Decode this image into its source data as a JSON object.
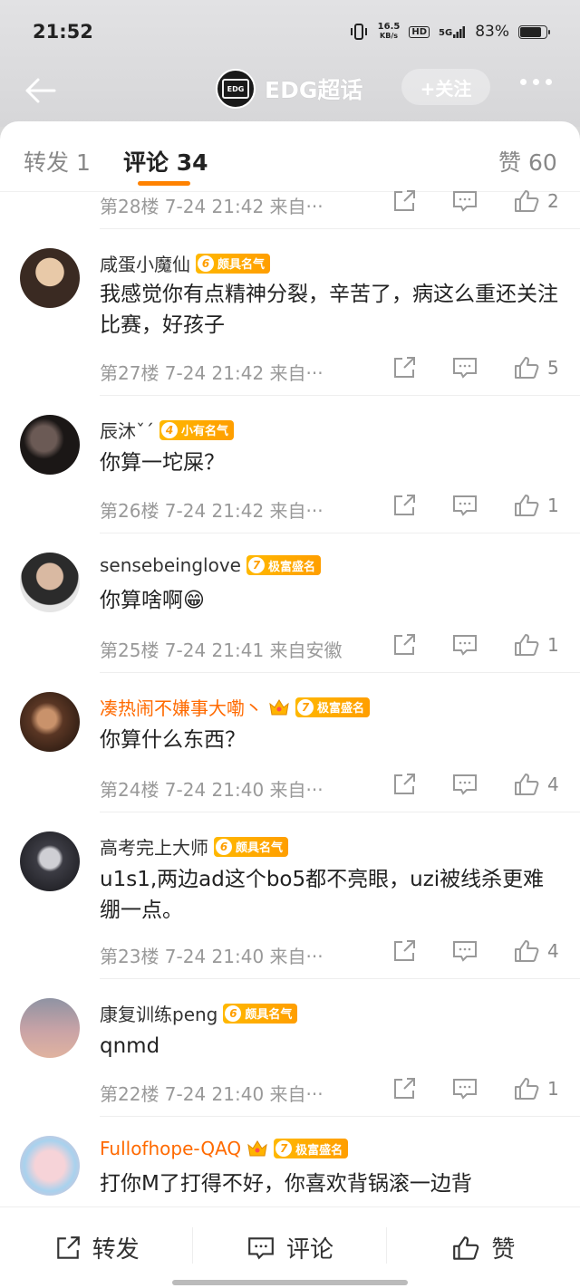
{
  "status_bar": {
    "time": "21:52",
    "net_speed_top": "16.5",
    "net_speed_bottom": "KB/s",
    "hd": "HD",
    "signal": "5G",
    "battery": "83%",
    "battery_level": 0.83
  },
  "header": {
    "logo_text": "EDG",
    "title": "EDG超话",
    "follow_label": "+关注"
  },
  "tabs": {
    "repost": "转发 1",
    "comments": "评论 34",
    "likes": "赞 60"
  },
  "comments": [
    {
      "floor_meta": "第28楼  7-24 21:42  来自···",
      "likes": "2"
    },
    {
      "username": "咸蛋小魔仙",
      "level": "6",
      "badge": "颇具名气",
      "text": "我感觉你有点精神分裂，辛苦了，病这么重还关注比赛，好孩子",
      "floor_meta": "第27楼  7-24 21:42  来自···",
      "likes": "5"
    },
    {
      "username": "辰沐ˇˊ",
      "level": "4",
      "badge": "小有名气",
      "text": "你算一坨屎？",
      "floor_meta": "第26楼  7-24 21:42  来自···",
      "likes": "1"
    },
    {
      "username": "sensebeinglove",
      "level": "7",
      "badge": "极富盛名",
      "text": "你算啥啊😁",
      "floor_meta": "第25楼  7-24 21:41  来自安徽",
      "likes": "1"
    },
    {
      "username": "凑热闹不嫌事大嘞丶",
      "level": "7",
      "badge": "极富盛名",
      "text": "你算什么东西？",
      "floor_meta": "第24楼  7-24 21:40  来自···",
      "likes": "4"
    },
    {
      "username": "高考完上大师",
      "level": "6",
      "badge": "颇具名气",
      "text": "u1s1,两边ad这个bo5都不亮眼，uzi被线杀更难绷一点。",
      "floor_meta": "第23楼  7-24 21:40  来自···",
      "likes": "4"
    },
    {
      "username": "康复训练peng",
      "level": "6",
      "badge": "颇具名气",
      "text": "qnmd",
      "floor_meta": "第22楼  7-24 21:40  来自···",
      "likes": "1"
    },
    {
      "username": "Fullofhope-QAQ",
      "level": "7",
      "badge": "极富盛名",
      "text": "打你M了打得不好，你喜欢背锅滚一边背"
    }
  ],
  "bottom_bar": {
    "repost": "转发",
    "comment": "评论",
    "like": "赞"
  },
  "colors": {
    "accent": "#ff8200",
    "vip_name": "#ff6a00",
    "badge": "#ffa800"
  }
}
